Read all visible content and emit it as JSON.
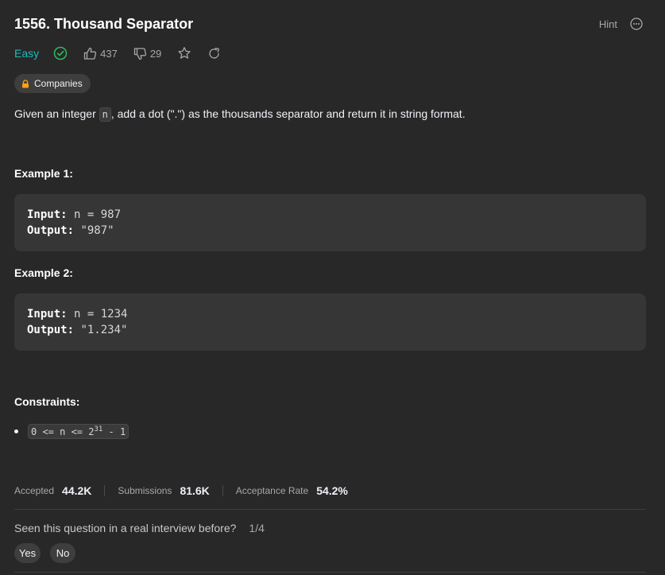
{
  "problem": {
    "title": "1556. Thousand Separator",
    "difficulty": "Easy",
    "likes": "437",
    "dislikes": "29",
    "companies_label": "Companies",
    "hint_label": "Hint"
  },
  "description": {
    "prefix": "Given an integer ",
    "var": "n",
    "suffix": ", add a dot (\".\") as the thousands separator and return it in string format."
  },
  "examples": [
    {
      "title": "Example 1:",
      "input_label": "Input:",
      "input": " n = 987",
      "output_label": "Output:",
      "output": " \"987\""
    },
    {
      "title": "Example 2:",
      "input_label": "Input:",
      "input": " n = 1234",
      "output_label": "Output:",
      "output": " \"1.234\""
    }
  ],
  "constraints": {
    "title": "Constraints:",
    "item_prefix": "0 <= n <= 2",
    "item_sup": "31",
    "item_suffix": " - 1"
  },
  "stats": {
    "accepted_label": "Accepted",
    "accepted": "44.2K",
    "submissions_label": "Submissions",
    "submissions": "81.6K",
    "rate_label": "Acceptance Rate",
    "rate": "54.2%"
  },
  "interview": {
    "question": "Seen this question in a real interview before?",
    "fraction": "1/4",
    "yes": "Yes",
    "no": "No"
  },
  "colors": {
    "easy": "#1cbaba",
    "background": "#282828",
    "code_bg": "#363636"
  }
}
